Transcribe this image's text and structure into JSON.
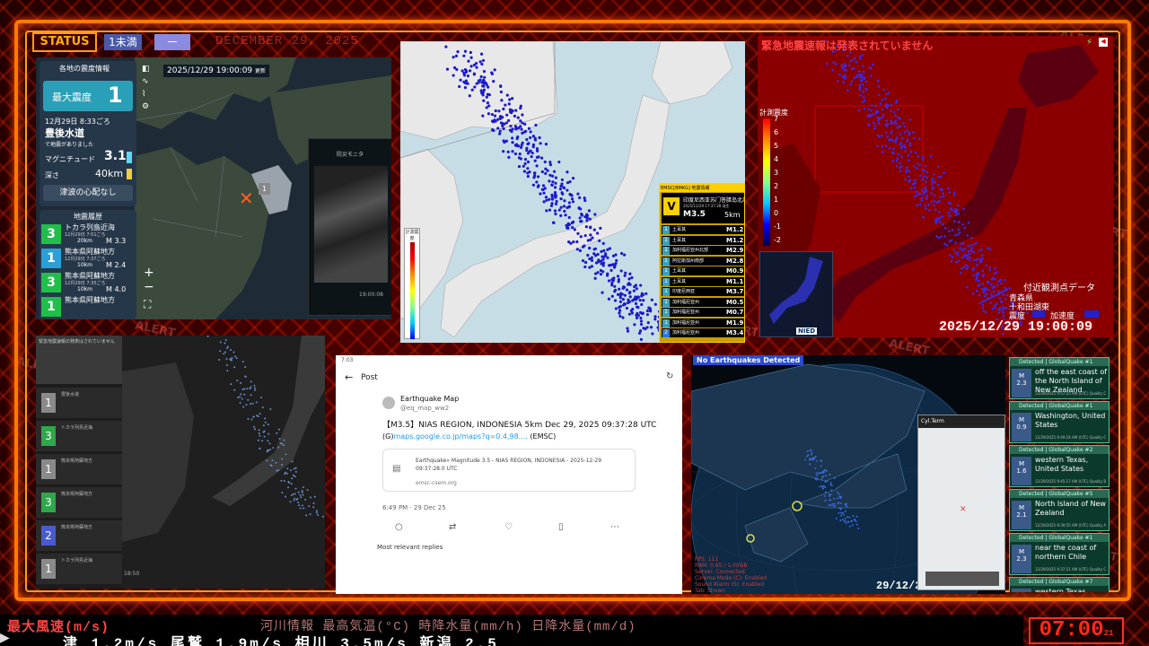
{
  "header": {
    "status_label": "STATUS",
    "status_level": "1未満",
    "status_dash": "ー",
    "ghost_date": "DECEMBER 29, 2025",
    "alert_text": "ALERT"
  },
  "panel_quake_info": {
    "title": "各地の震度情報",
    "timestamp": "2025/12/29 19:00:09",
    "timestamp_suffix": "更新",
    "max_intensity_label": "最大震度",
    "max_intensity": "1",
    "datetime": "12月29日 8:33ごろ",
    "region": "豊後水道",
    "occurred": "で地震がありました",
    "magnitude_label": "マグニチュード",
    "magnitude": "3.1",
    "depth_label": "深さ",
    "depth": "40km",
    "tsunami": "津波の心配なし",
    "history_title": "地震履歴",
    "map_intensity": "1",
    "phone_title": "防災モニタ",
    "phone_time": "19:00:08",
    "history": [
      {
        "intensity": "3",
        "place": "トカラ列島近海",
        "time": "12月29日 7:51ごろ",
        "depth": "20km",
        "mag": "M 3.3",
        "color": "#1fbf4a"
      },
      {
        "intensity": "1",
        "place": "熊本県阿蘇地方",
        "time": "12月29日 7:37ごろ",
        "depth": "10km",
        "mag": "M 2.4",
        "color": "#2aa0d8"
      },
      {
        "intensity": "3",
        "place": "熊本県阿蘇地方",
        "time": "12月29日 7:35ごろ",
        "depth": "10km",
        "mag": "M 4.0",
        "color": "#1fbf4a"
      },
      {
        "intensity": "1",
        "place": "熊本県阿蘇地方",
        "time": "",
        "depth": "",
        "mag": "",
        "color": "#1fbf4a"
      }
    ]
  },
  "panel_japan_map": {
    "legend_title": "計測震度",
    "emsc_header": "EMSC[BMKG] 地震情報",
    "emsc_intensity": "V",
    "emsc_place": "印度尼西亚苏门答腊岛北部",
    "emsc_time": "2025/12/29 17:37:28 発生",
    "emsc_mag": "M3.5",
    "emsc_depth": "5km",
    "emsc_list": [
      {
        "level": "1",
        "name": "土耳其",
        "mag": "M1.2"
      },
      {
        "level": "1",
        "name": "土耳其",
        "mag": "M1.2"
      },
      {
        "level": "1",
        "name": "加利福尼亚州北部",
        "mag": "M2.9"
      },
      {
        "level": "1",
        "name": "阿拉斯加州南部",
        "mag": "M2.8"
      },
      {
        "level": "1",
        "name": "土耳其",
        "mag": "M0.9"
      },
      {
        "level": "1",
        "name": "土耳其",
        "mag": "M1.1"
      },
      {
        "level": "1",
        "name": "印度尼西亚",
        "mag": "M3.7"
      },
      {
        "level": "1",
        "name": "加利福尼亚州",
        "mag": "M0.5"
      },
      {
        "level": "1",
        "name": "加利福尼亚州",
        "mag": "M0.7"
      },
      {
        "level": "1",
        "name": "加利福尼亚州",
        "mag": "M1.9"
      },
      {
        "level": "2",
        "name": "加利福尼亚州",
        "mag": "M3.4"
      }
    ]
  },
  "panel_kmoni": {
    "eew_status": "緊急地震速報は発表されていません",
    "scale_title": "計測震度",
    "scale_ticks": [
      "7",
      "6",
      "5",
      "4",
      "3",
      "2",
      "1",
      "0",
      "-1",
      "-2"
    ],
    "nearby_title": "付近観測点データ",
    "pref": "青森県",
    "station": "十和田湖東",
    "label_int": "震度",
    "label_acc": "加速度",
    "datetime": "2025/12/29 19:00:09",
    "nied": "NIED"
  },
  "panel_dark_list": {
    "header": "緊急地震速報の発表はされていません",
    "items": [
      {
        "level": "1",
        "color": "#8a8a8a",
        "place": "豊後水道"
      },
      {
        "level": "3",
        "color": "#2fa84a",
        "place": "トカラ列島近海"
      },
      {
        "level": "1",
        "color": "#8a8a8a",
        "place": "熊本県阿蘇地方"
      },
      {
        "level": "3",
        "color": "#2fa84a",
        "place": "熊本県阿蘇地方"
      },
      {
        "level": "2",
        "color": "#4a5ad0",
        "place": "熊本県阿蘇地方"
      },
      {
        "level": "1",
        "color": "#8a8a8a",
        "place": "トカラ列島近海"
      }
    ]
  },
  "panel_post": {
    "time": "7:03",
    "title": "Post",
    "author": "Earthquake Map",
    "handle": "@eq_map_ww2",
    "body": "【M3.5】NIAS REGION, INDONESIA 5km Dec 29, 2025 09:37:28 UTC",
    "link_prefix": "(G)",
    "link": "maps.google.co.jp/maps?q=0.4,98....",
    "link_suffix": " (EMSC)",
    "card_text": "Earthquake» Magnitude 3.5 - NIAS REGION, INDONESIA - 2025-12-29 09:37:28.0 UTC",
    "card_domain": "emsc-csem.org",
    "posted": "6:49 PM · 29 Dec 25",
    "replies": "Most relevant replies"
  },
  "panel_globe": {
    "banner": "No Earthquakes Detected",
    "date": "29/12/2",
    "inset_title": "Cyl.Term",
    "stats": [
      "FPS: 111",
      "RAM: 0.65 / 1.00GB",
      "Server: Connected",
      "Cinema Mode (C): Enabled",
      "Sound Alarm (S): Enabled",
      "Tab: Shown"
    ],
    "quakes": [
      {
        "num": "#1",
        "mag": "2.3",
        "title": "off the east coast of the North Island of New Zealand",
        "info": "12/29/2025 9:57:25 AM (UTC)",
        "q": "Quality C"
      },
      {
        "num": "#1",
        "mag": "0.9",
        "title": "Washington, United States",
        "info": "12/29/2025 9:49:24 AM (UTC)",
        "q": "Quality C"
      },
      {
        "num": "#2",
        "mag": "1.6",
        "title": "western Texas, United States",
        "info": "12/29/2025 9:45:17 AM (UTC)",
        "q": "Quality B"
      },
      {
        "num": "#5",
        "mag": "2.1",
        "title": "North Island of New Zealand",
        "info": "12/29/2025 9:39:55 AM (UTC)",
        "q": "Quality A"
      },
      {
        "num": "#1",
        "mag": "2.3",
        "title": "near the coast of northern Chile",
        "info": "12/29/2025 9:37:21 AM (UTC)",
        "q": "Quality C"
      },
      {
        "num": "#7",
        "mag": "",
        "title": "western Texas",
        "info": "",
        "q": ""
      }
    ],
    "qcard_header": "Detected | GlobalQuake"
  },
  "ticker": {
    "line1": "最大風速(m/s)",
    "line1b": "河川情報   最高気温(°C)   時降水量(mm/h)   日降水量(mm/d)",
    "line2": "津 1.2m/s    尾鷲 1.9m/s    相川 3.5m/s    新潟 2.5",
    "clock": "07:00",
    "clock_sub": "21"
  },
  "colors": {
    "frame": "#ff7a00",
    "alert_red": "#ff2a1a",
    "quake_blue": "#1a1acc"
  }
}
